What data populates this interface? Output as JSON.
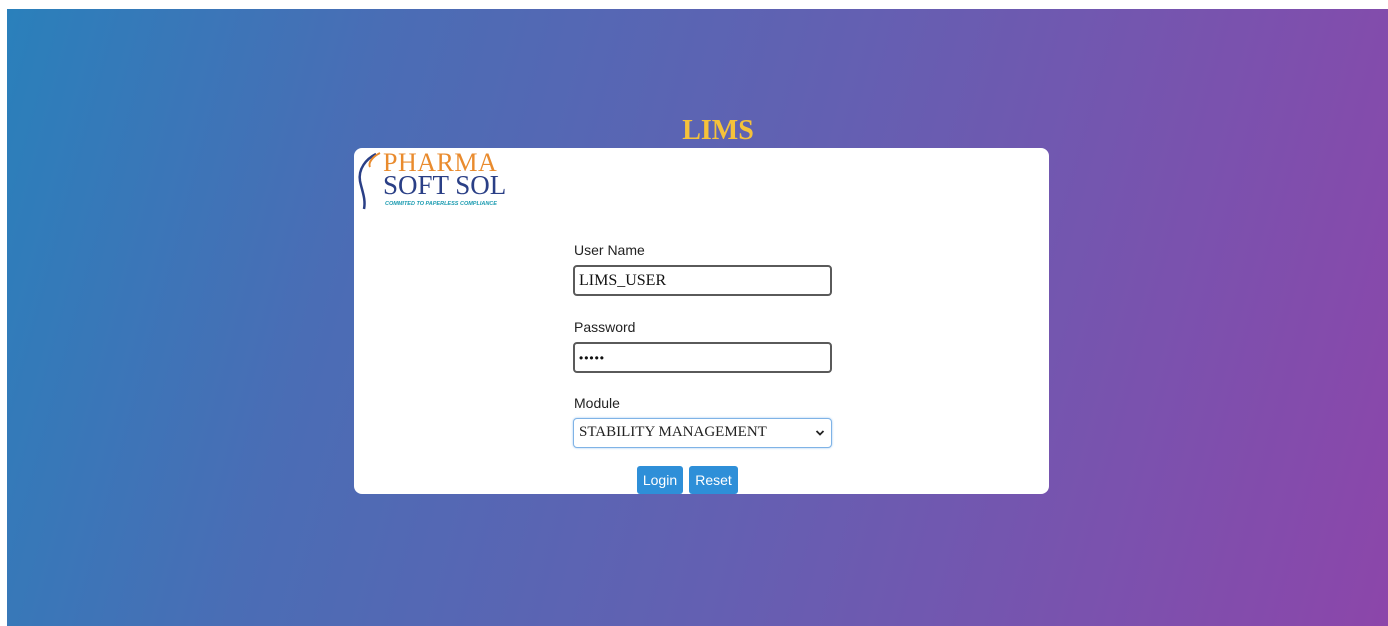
{
  "header": {
    "title": "LIMS"
  },
  "logo": {
    "line1": "PHARMA",
    "line2": "SOFT SOL",
    "tagline": "COMMITED TO PAPERLESS COMPLIANCE"
  },
  "form": {
    "username": {
      "label": "User Name",
      "value": "LIMS_USER"
    },
    "password": {
      "label": "Password",
      "value": "•••••"
    },
    "module": {
      "label": "Module",
      "selected": "STABILITY MANAGEMENT"
    },
    "login_label": "Login",
    "reset_label": "Reset"
  },
  "colors": {
    "title": "#f5c23a",
    "button": "#2e8fd8",
    "gradient_start": "#2a80bb",
    "gradient_end": "#8c46aa"
  },
  "icons": {
    "logo_swoosh": "swoosh-icon",
    "select_arrow": "chevron-down-icon"
  }
}
